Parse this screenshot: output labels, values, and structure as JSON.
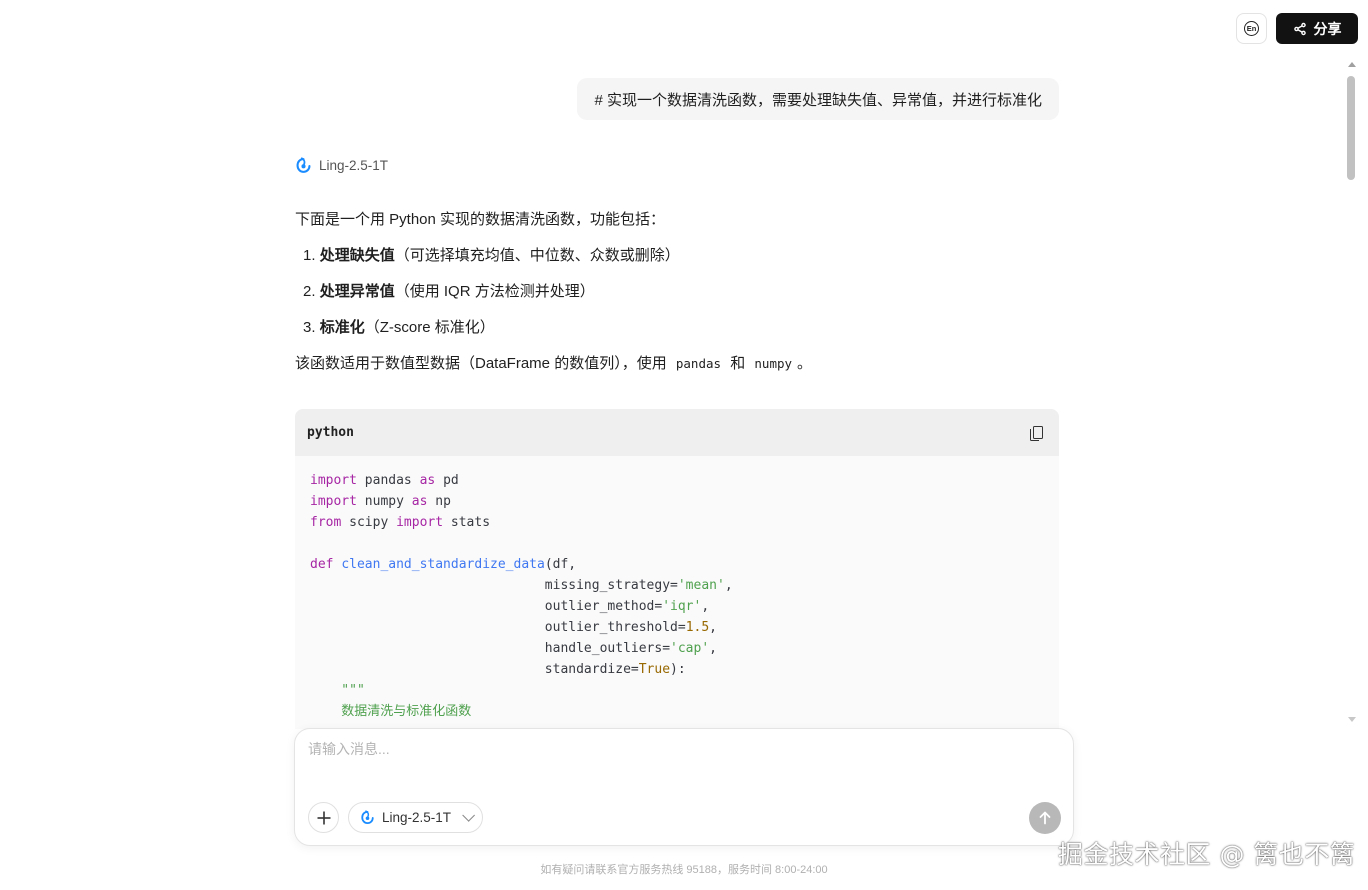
{
  "header": {
    "lang_label": "En",
    "share_label": "分享"
  },
  "conversation": {
    "user_message": "# 实现一个数据清洗函数，需要处理缺失值、异常值，并进行标准化",
    "model_name": "Ling-2.5-1T",
    "intro": "下面是一个用 Python 实现的数据清洗函数，功能包括：",
    "features": [
      {
        "num": "1.",
        "title": "处理缺失值",
        "desc": "（可选择填充均值、中位数、众数或删除）"
      },
      {
        "num": "2.",
        "title": "处理异常值",
        "desc": "（使用 IQR 方法检测并处理）"
      },
      {
        "num": "3.",
        "title": "标准化",
        "desc": "（Z-score 标准化）"
      }
    ],
    "usage_prefix": "该函数适用于数值型数据（DataFrame 的数值列），使用",
    "usage_lib1": "pandas",
    "usage_and": "和",
    "usage_lib2": "numpy",
    "usage_suffix": "。"
  },
  "code_block": {
    "language": "python",
    "lines": [
      [
        [
          "kw",
          "import"
        ],
        [
          "t",
          " pandas "
        ],
        [
          "kw",
          "as"
        ],
        [
          "t",
          " pd"
        ]
      ],
      [
        [
          "kw",
          "import"
        ],
        [
          "t",
          " numpy "
        ],
        [
          "kw",
          "as"
        ],
        [
          "t",
          " np"
        ]
      ],
      [
        [
          "kw",
          "from"
        ],
        [
          "t",
          " scipy "
        ],
        [
          "kw",
          "import"
        ],
        [
          "t",
          " stats"
        ]
      ],
      [
        [
          "t",
          ""
        ]
      ],
      [
        [
          "kw",
          "def"
        ],
        [
          "t",
          " "
        ],
        [
          "fn",
          "clean_and_standardize_data"
        ],
        [
          "t",
          "(df,"
        ]
      ],
      [
        [
          "t",
          "                              missing_strategy="
        ],
        [
          "str",
          "'mean'"
        ],
        [
          "t",
          ","
        ]
      ],
      [
        [
          "t",
          "                              outlier_method="
        ],
        [
          "str",
          "'iqr'"
        ],
        [
          "t",
          ","
        ]
      ],
      [
        [
          "t",
          "                              outlier_threshold="
        ],
        [
          "num",
          "1.5"
        ],
        [
          "t",
          ","
        ]
      ],
      [
        [
          "t",
          "                              handle_outliers="
        ],
        [
          "str",
          "'cap'"
        ],
        [
          "t",
          ","
        ]
      ],
      [
        [
          "t",
          "                              standardize="
        ],
        [
          "num",
          "True"
        ],
        [
          "t",
          "):"
        ]
      ],
      [
        [
          "doc",
          "    \"\"\""
        ]
      ],
      [
        [
          "doc",
          "    数据清洗与标准化函数"
        ]
      ]
    ]
  },
  "composer": {
    "placeholder": "请输入消息...",
    "model_name": "Ling-2.5-1T"
  },
  "footer_text": "如有疑问请联系官方服务热线 95188，服务时间 8:00-24:00",
  "watermark": "掘金技术社区 @ 篱也不篱"
}
